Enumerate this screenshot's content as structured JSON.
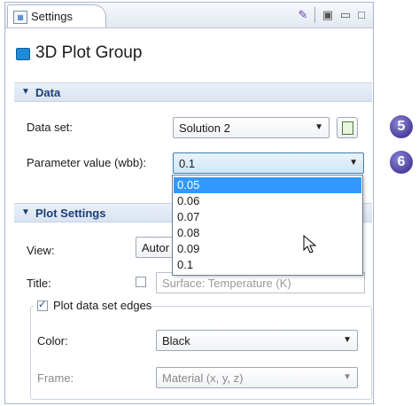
{
  "window": {
    "tab_label": "Settings",
    "toolbar_icons": [
      "brush-icon",
      "help-icon",
      "minimize-icon",
      "maximize-icon"
    ]
  },
  "header": {
    "title": "3D Plot Group"
  },
  "data_section": {
    "title": "Data",
    "data_set_label": "Data set:",
    "data_set_value": "Solution 2",
    "param_label": "Parameter value (wbb):",
    "param_value": "0.1",
    "param_options": [
      "0.05",
      "0.06",
      "0.07",
      "0.08",
      "0.09",
      "0.1"
    ],
    "highlighted_option": "0.05"
  },
  "plot_settings": {
    "title": "Plot Settings",
    "view_label": "View:",
    "view_value": "Autor",
    "title_label": "Title:",
    "title_value": "Surface: Temperature (K)",
    "title_checked": false,
    "edges_label": "Plot data set edges",
    "edges_checked": true,
    "color_label": "Color:",
    "color_value": "Black",
    "frame_label": "Frame:",
    "frame_value": "Material  (x, y, z)"
  },
  "callouts": {
    "first": "5",
    "second": "6"
  },
  "colors": {
    "accent": "#1c3f75",
    "selection": "#3399ff",
    "badge": "#4b3f9c"
  }
}
